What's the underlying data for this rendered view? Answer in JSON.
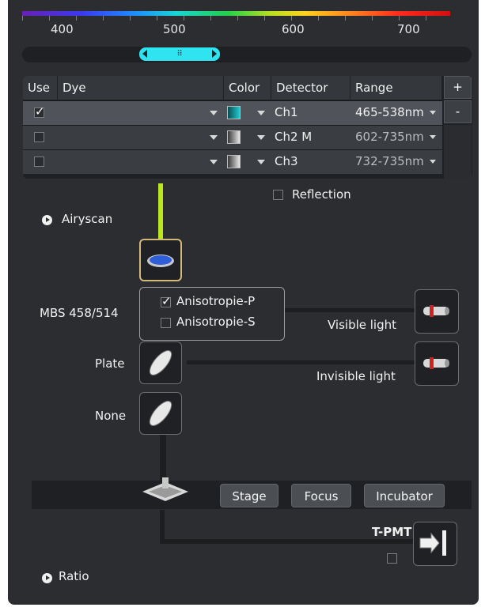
{
  "spectrum": {
    "tick_labels": [
      "400",
      "500",
      "600",
      "700"
    ],
    "range_selector": {
      "thumb_grip": "⠿"
    }
  },
  "dye_table": {
    "headers": {
      "use": "Use",
      "dye": "Dye",
      "color": "Color",
      "detector": "Detector",
      "range": "Range"
    },
    "add_button": "+",
    "remove_button": "-",
    "rows": [
      {
        "use": true,
        "dye": "",
        "color": "#1ecbd0",
        "detector": "Ch1",
        "range": "465-538nm"
      },
      {
        "use": false,
        "dye": "",
        "color": "#d8d8d8",
        "detector": "Ch2 M",
        "range": "602-735nm"
      },
      {
        "use": false,
        "dye": "",
        "color": "#d8d8d8",
        "detector": "Ch3",
        "range": "732-735nm"
      }
    ]
  },
  "reflection": {
    "label": "Reflection",
    "checked": false
  },
  "airyscan": {
    "label": "Airyscan"
  },
  "beam_path": {
    "mbs_label": "MBS 458/514",
    "plate_label": "Plate",
    "none_label": "None",
    "popup": {
      "items": [
        {
          "label": "Anisotropie-P",
          "checked": true
        },
        {
          "label": "Anisotropie-S",
          "checked": false
        }
      ]
    },
    "visible_light": "Visible light",
    "invisible_light": "Invisible light"
  },
  "stage_bar": {
    "buttons": [
      "Stage",
      "Focus",
      "Incubator"
    ]
  },
  "tpmt": {
    "label": "T-PMT",
    "checked": false
  },
  "ratio": {
    "label": "Ratio"
  },
  "colors": {
    "beam": "#b9e61e",
    "accent": "#2fe3f0",
    "selected_border": "#d4b87a",
    "panel": "#2b2d30"
  }
}
